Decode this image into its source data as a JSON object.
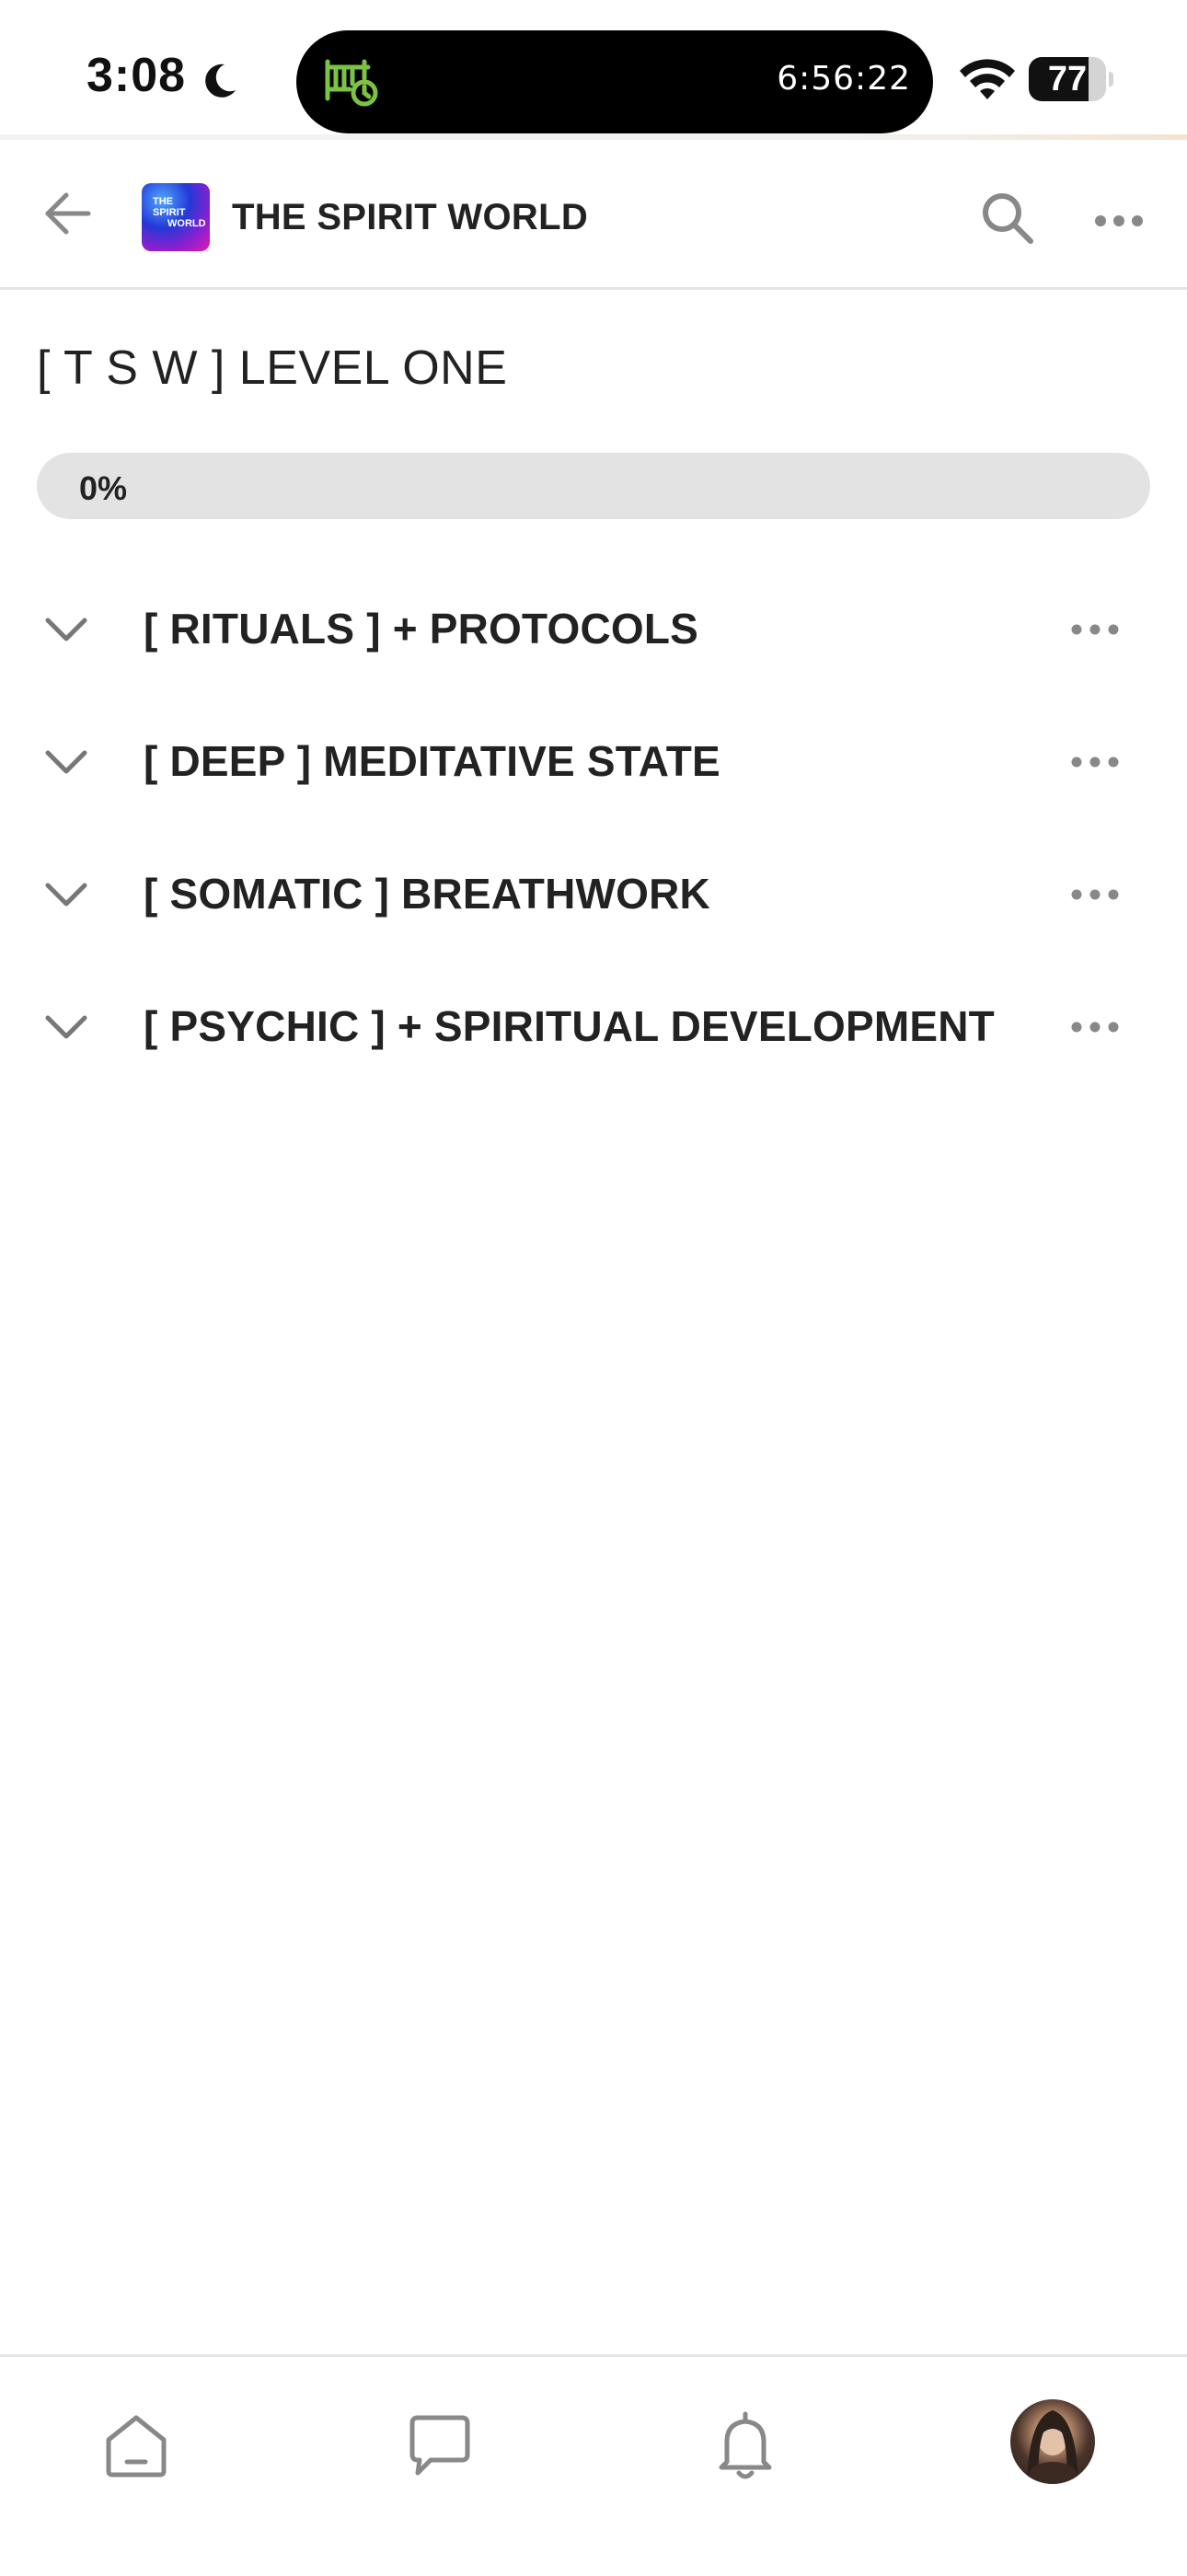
{
  "status_bar": {
    "time": "3:08",
    "island_timer": "6:56:22",
    "battery_level": "77",
    "battery_fraction": 0.77,
    "icons": [
      "moon-icon",
      "app-activity-icon",
      "wifi-icon",
      "battery-icon"
    ]
  },
  "header": {
    "community_name": "THE SPIRIT WORLD",
    "logo_text": [
      "THE",
      "SPIRIT",
      "WORLD"
    ],
    "icons": [
      "back-arrow-icon",
      "search-icon",
      "more-horizontal-icon"
    ]
  },
  "course": {
    "title": "[ T S W ] LEVEL ONE",
    "progress_label": "0%",
    "progress_fraction": 0.0
  },
  "modules": [
    {
      "label": "[ RITUALS ] + PROTOCOLS"
    },
    {
      "label": "[ DEEP ] MEDITATIVE STATE"
    },
    {
      "label": "[ SOMATIC ] BREATHWORK"
    },
    {
      "label": "[ PSYCHIC ] + SPIRITUAL DEVELOPMENT"
    }
  ],
  "bottom_nav": {
    "items": [
      "home-icon",
      "chat-icon",
      "bell-icon",
      "avatar"
    ]
  },
  "colors": {
    "text": "#222222",
    "icon_gray": "#888888",
    "progress_track": "#e3e3e3",
    "divider": "#e4e4e4",
    "island_icon_green": "#7cc243"
  }
}
